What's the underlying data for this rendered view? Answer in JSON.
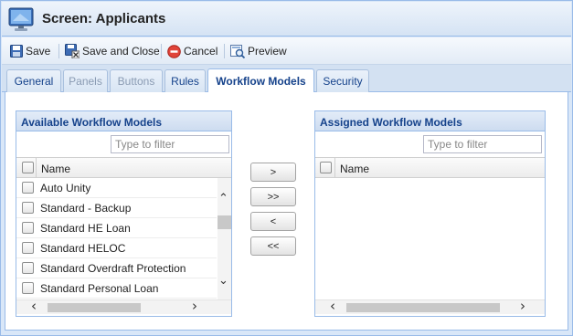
{
  "window": {
    "title": "Screen: Applicants"
  },
  "icons": {
    "app": "monitor-icon",
    "save": "floppy-disk-icon",
    "save_close": "save-close-icon",
    "cancel": "cancel-icon",
    "preview": "preview-icon"
  },
  "toolbar": {
    "save_label": "Save",
    "save_close_label": "Save and Close",
    "cancel_label": "Cancel",
    "preview_label": "Preview"
  },
  "tabs": [
    {
      "label": "General",
      "state": "enabled"
    },
    {
      "label": "Panels",
      "state": "disabled"
    },
    {
      "label": "Buttons",
      "state": "disabled"
    },
    {
      "label": "Rules",
      "state": "enabled"
    },
    {
      "label": "Workflow Models",
      "state": "active"
    },
    {
      "label": "Security",
      "state": "enabled"
    }
  ],
  "available": {
    "title": "Available Workflow Models",
    "filter_placeholder": "Type to filter",
    "column_name": "Name",
    "rows": [
      "Auto Unity",
      "Standard - Backup",
      "Standard HE Loan",
      "Standard HELOC",
      "Standard Overdraft Protection",
      "Standard Personal Loan"
    ]
  },
  "assigned": {
    "title": "Assigned Workflow Models",
    "filter_placeholder": "Type to filter",
    "column_name": "Name",
    "rows": []
  },
  "move_buttons": {
    "add_one": ">",
    "add_all": ">>",
    "remove_one": "<",
    "remove_all": "<<"
  },
  "colors": {
    "border": "#99bbe8",
    "header_text": "#15428b",
    "window_bg": "#d9e7f8"
  }
}
